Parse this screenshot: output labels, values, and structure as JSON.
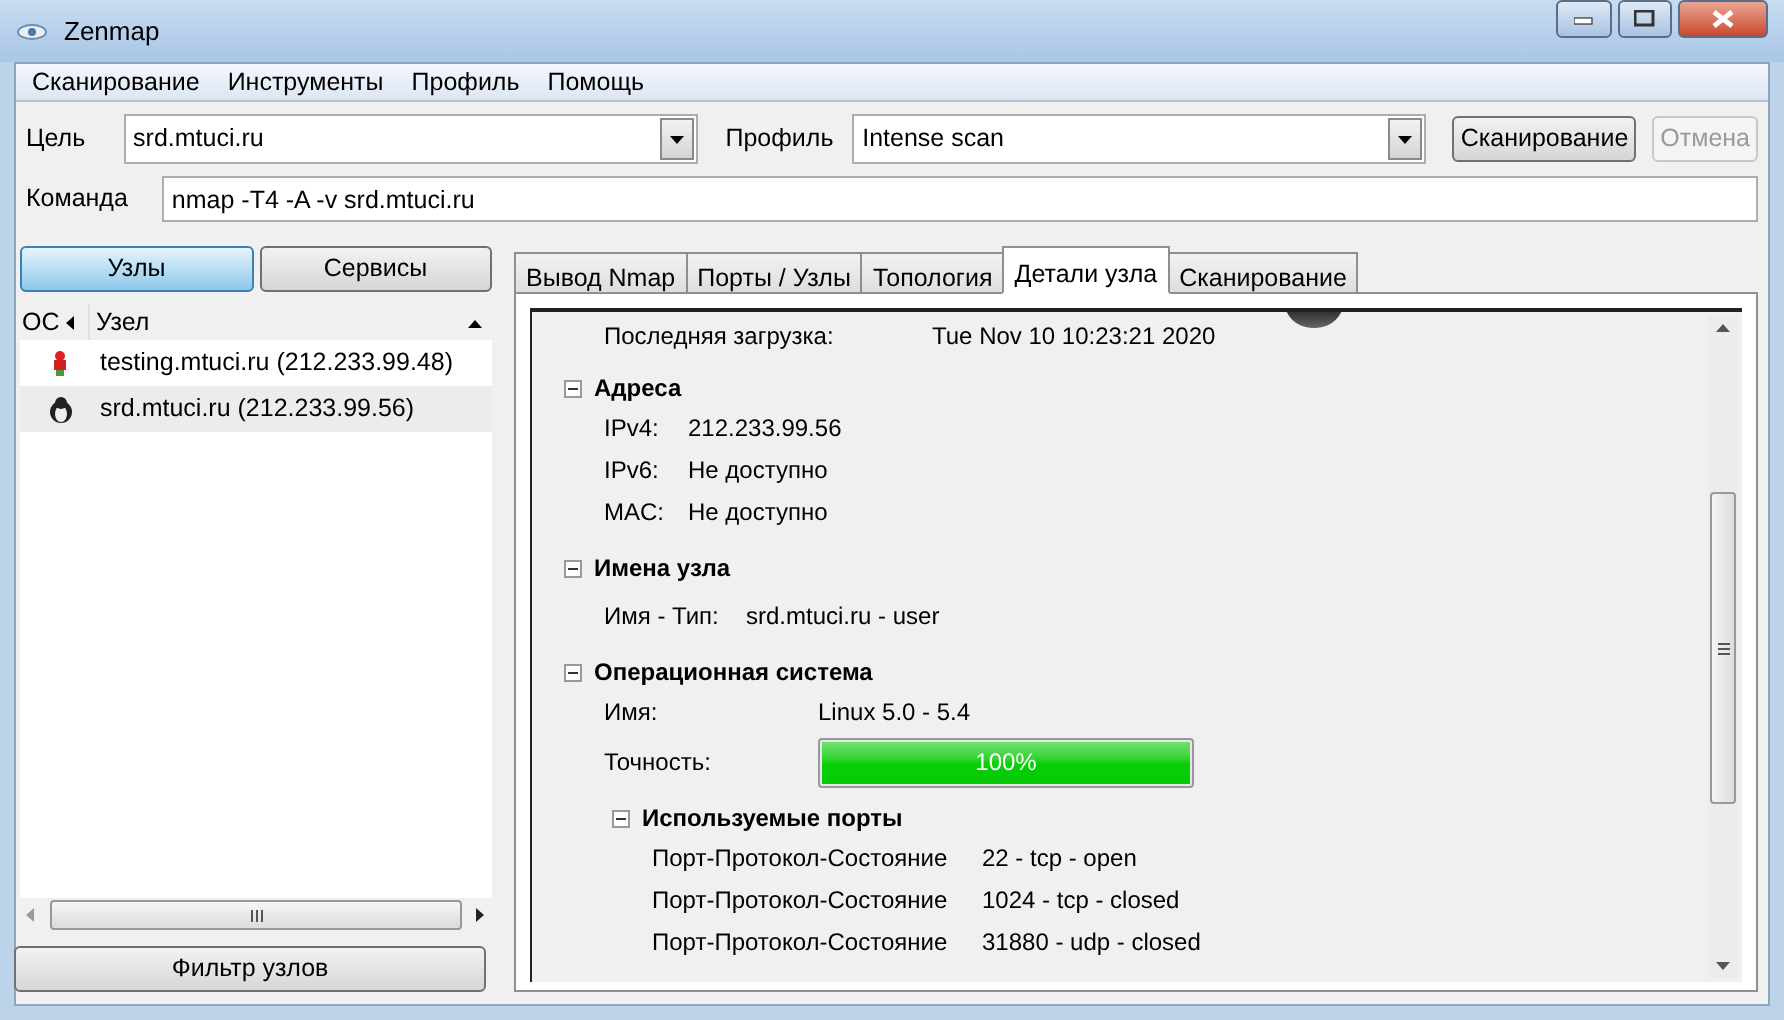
{
  "window": {
    "title": "Zenmap"
  },
  "menu": [
    "Сканирование",
    "Инструменты",
    "Профиль",
    "Помощь"
  ],
  "target": {
    "label": "Цель",
    "value": "srd.mtuci.ru"
  },
  "profile": {
    "label": "Профиль",
    "value": "Intense scan"
  },
  "scan_button": {
    "label": "Сканирование",
    "disabled": false
  },
  "cancel_button": {
    "label": "Отмена",
    "disabled": true
  },
  "command": {
    "label": "Команда",
    "value": "nmap -T4 -A -v srd.mtuci.ru"
  },
  "view_buttons": [
    {
      "label": "Узлы",
      "selected": true
    },
    {
      "label": "Сервисы",
      "selected": false
    }
  ],
  "host_list": {
    "columns": [
      "ОС",
      "Узел"
    ],
    "rows": [
      {
        "kind": "other",
        "host": "testing.mtuci.ru (212.233.99.48)",
        "selected": false
      },
      {
        "kind": "linux",
        "host": "srd.mtuci.ru (212.233.99.56)",
        "selected": true
      }
    ]
  },
  "filter_button": "Фильтр узлов",
  "tabs": [
    {
      "label": "Вывод Nmap",
      "selected": false
    },
    {
      "label": "Порты / Узлы",
      "selected": false
    },
    {
      "label": "Топология",
      "selected": false
    },
    {
      "label": "Детали узла",
      "selected": true
    },
    {
      "label": "Сканирование",
      "selected": false
    }
  ],
  "details": {
    "last_boot": {
      "label": "Последняя загрузка:",
      "value": "Tue Nov 10 10:23:21 2020"
    },
    "addresses": {
      "title": "Адреса",
      "expanded": true,
      "fields": [
        {
          "label": "IPv4:",
          "value": "212.233.99.56"
        },
        {
          "label": "IPv6:",
          "value": "Не доступно"
        },
        {
          "label": "MAC:",
          "value": "Не доступно"
        }
      ]
    },
    "hostnames": {
      "title": "Имена узла",
      "expanded": true,
      "fields": [
        {
          "label": "Имя - Тип:",
          "value": "srd.mtuci.ru - user"
        }
      ]
    },
    "os": {
      "title": "Операционная система",
      "expanded": true,
      "name": {
        "label": "Имя:",
        "value": "Linux 5.0 - 5.4"
      },
      "accuracy": {
        "label": "Точность:",
        "level": 1,
        "text": "100%"
      },
      "ports_used": {
        "title": "Используемые порты",
        "expanded": true,
        "rows": [
          {
            "label": "Порт-Протокол-Состояние",
            "value": "22 - tcp - open"
          },
          {
            "label": "Порт-Протокол-Состояние",
            "value": "1024 - tcp - closed"
          },
          {
            "label": "Порт-Протокол-Состояние",
            "value": "31880 - udp - closed"
          }
        ]
      }
    }
  }
}
